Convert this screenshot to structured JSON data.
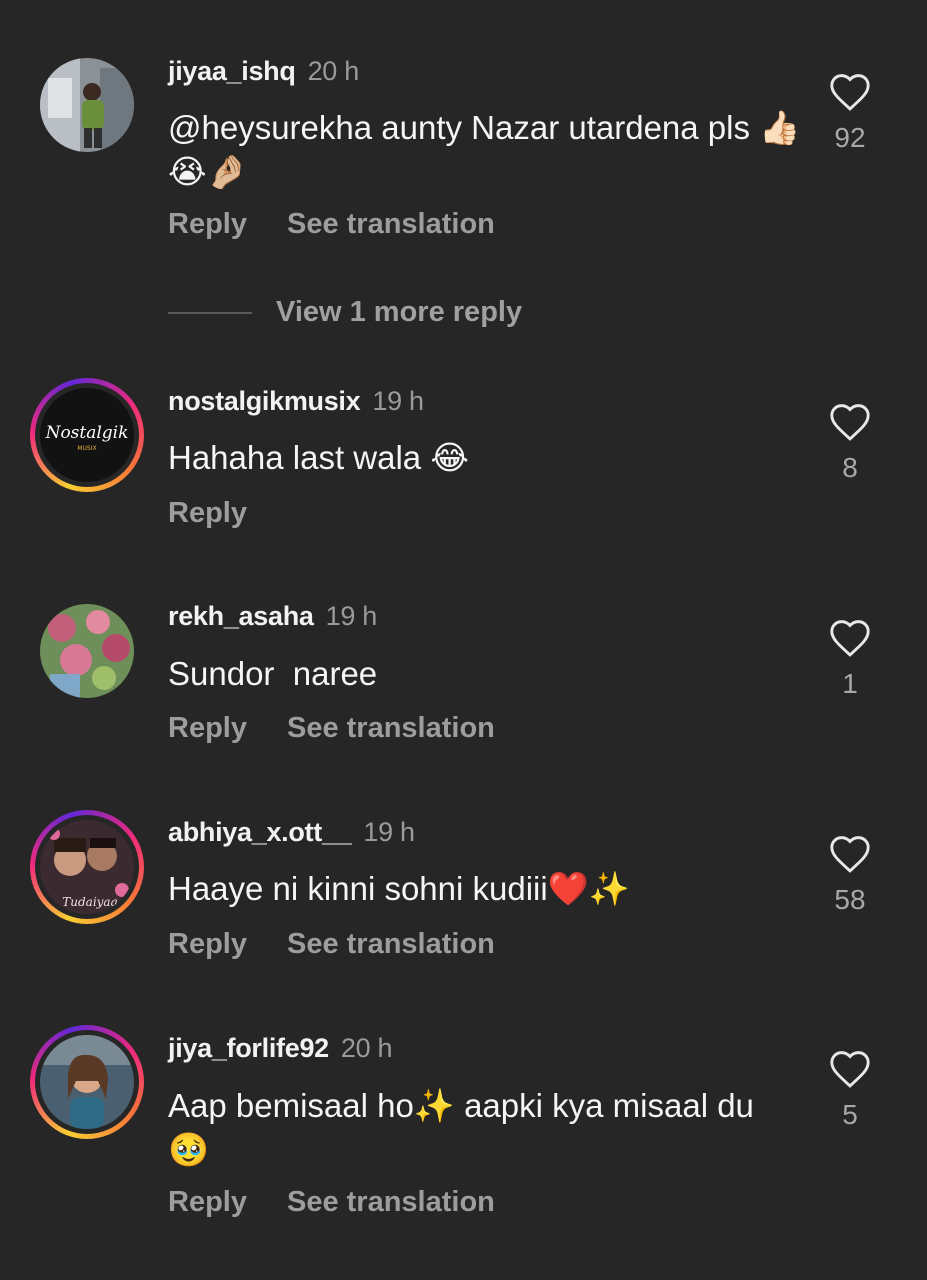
{
  "comments": [
    {
      "username": "jiyaa_ishq",
      "time": "20 h",
      "text": "@heysurekha aunty Nazar utardena pls 👍🏻😭🤌🏼",
      "reply": "Reply",
      "see_translation": "See translation",
      "likes": "92"
    },
    {
      "username": "nostalgikmusix",
      "time": "19 h",
      "text": "Hahaha last wala 😂",
      "reply": "Reply",
      "likes": "8",
      "avatar_text": "Nostalgik",
      "avatar_subtext": "MUSIX"
    },
    {
      "username": "rekh_asaha",
      "time": "19 h",
      "text": "Sundor  naree",
      "reply": "Reply",
      "see_translation": "See translation",
      "likes": "1"
    },
    {
      "username": "abhiya_x.ott__",
      "time": "19 h",
      "text": "Haaye ni kinni sohni kudiii❤️✨",
      "reply": "Reply",
      "see_translation": "See translation",
      "likes": "58",
      "avatar_text": "Tudaiyaa"
    },
    {
      "username": "jiya_forlife92",
      "time": "20 h",
      "text": "Aap bemisaal ho✨ aapki kya misaal du🥹",
      "reply": "Reply",
      "see_translation": "See translation",
      "likes": "5"
    }
  ],
  "view_more_replies": "View 1 more reply",
  "colors": {
    "background": "#262626",
    "secondary_text": "#9d9d9d",
    "story_ring": "#ee2a7b"
  },
  "icons": {
    "like": "heart-outline-icon"
  }
}
